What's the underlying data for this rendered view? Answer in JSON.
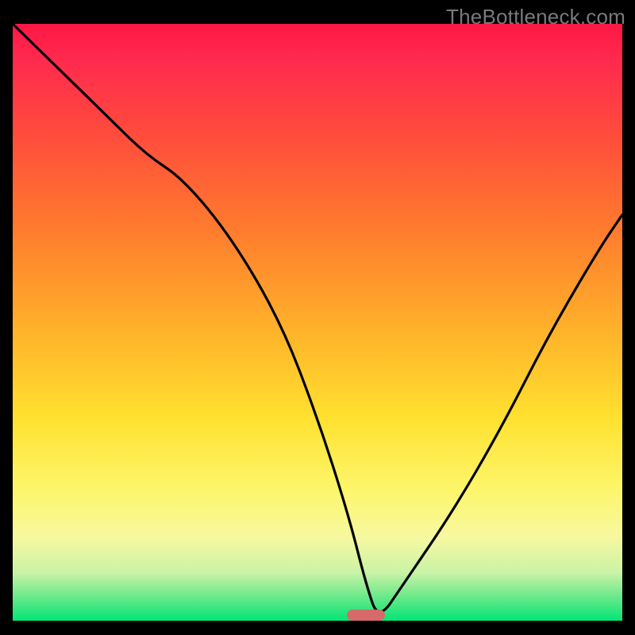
{
  "watermark": "TheBottleneck.com",
  "chart_data": {
    "type": "line",
    "title": "",
    "xlabel": "",
    "ylabel": "",
    "xlim": [
      0,
      100
    ],
    "ylim": [
      0,
      100
    ],
    "series": [
      {
        "name": "bottleneck-curve",
        "x": [
          0,
          8,
          16,
          22,
          28,
          36,
          44,
          50,
          55,
          58,
          60,
          64,
          72,
          80,
          88,
          96,
          100
        ],
        "values": [
          100,
          92,
          84,
          78,
          74,
          64,
          50,
          34,
          18,
          6,
          0,
          6,
          18,
          32,
          48,
          62,
          68
        ]
      }
    ],
    "annotations": [
      {
        "name": "minimum-marker",
        "x": 60,
        "y": 0
      }
    ],
    "grid": false,
    "legend": false
  },
  "marker": {
    "x_percent": 58
  }
}
